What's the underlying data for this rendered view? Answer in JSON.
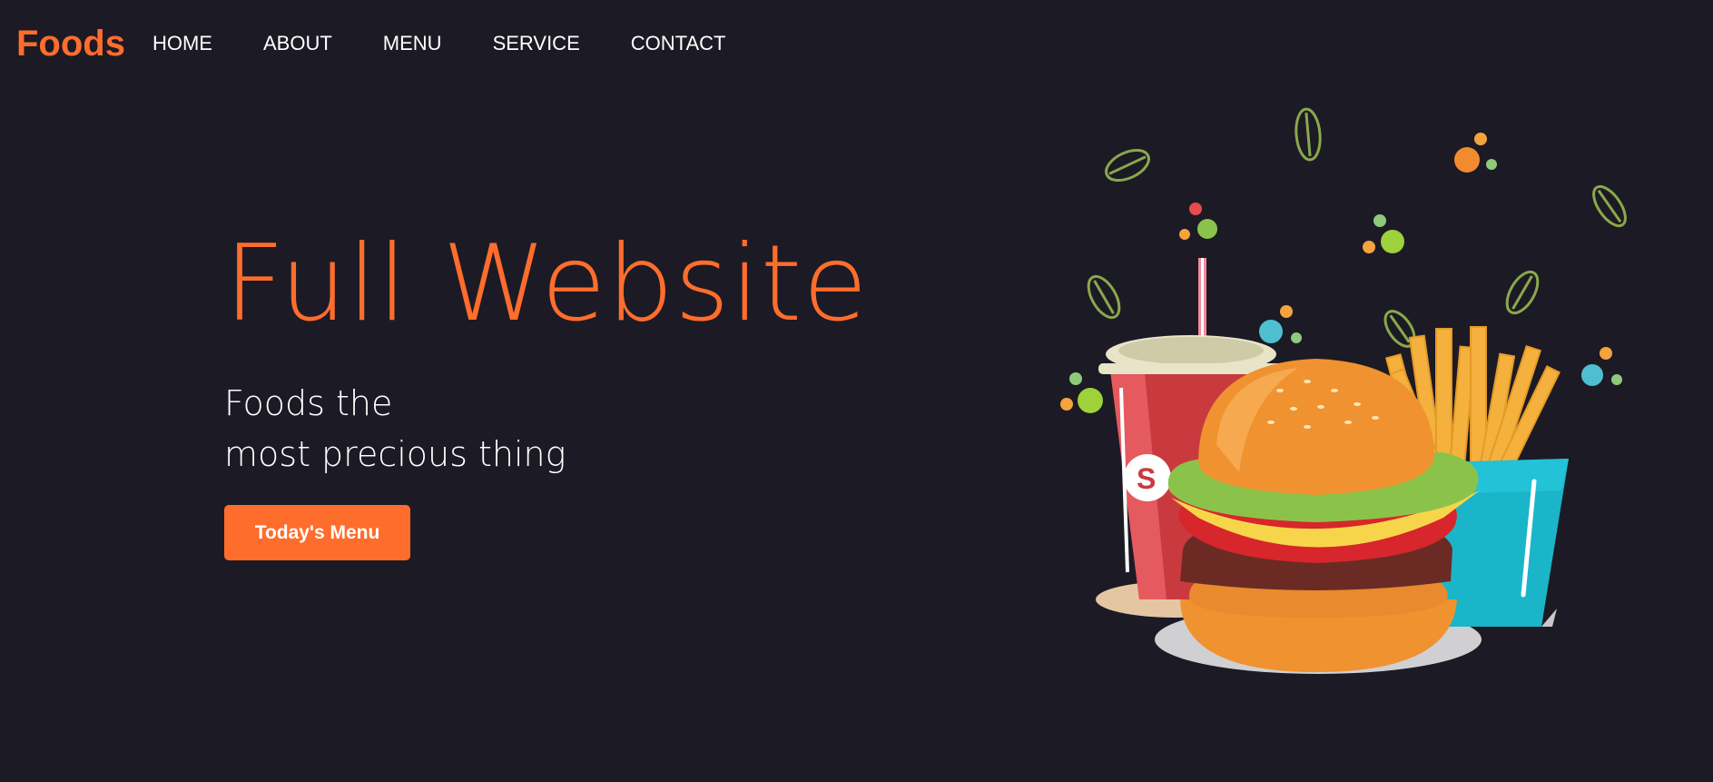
{
  "brand": {
    "name": "Foods",
    "accent_color": "#ff6d2d",
    "background_color": "#1c1a25"
  },
  "nav": {
    "items": [
      {
        "label": "HOME"
      },
      {
        "label": "ABOUT"
      },
      {
        "label": "MENU"
      },
      {
        "label": "SERVICE"
      },
      {
        "label": "CONTACT"
      }
    ]
  },
  "hero": {
    "title": "Full Website",
    "subtitle_line1": "Foods the",
    "subtitle_line2": "most precious thing",
    "cta_label": "Today's Menu"
  },
  "illustration": {
    "items": [
      "drink-cup",
      "burger",
      "fries",
      "leaves",
      "confetti-dots"
    ],
    "colors": {
      "leaf": "#8aa84b",
      "cup": "#c93a3f",
      "bun": "#f0922f",
      "lettuce": "#8bc34a",
      "tomato": "#d7262c",
      "patty": "#6b2b24",
      "fries": "#f5b13d",
      "fries_box": "#1bb5c9",
      "plate": "#d0d0d3"
    }
  }
}
